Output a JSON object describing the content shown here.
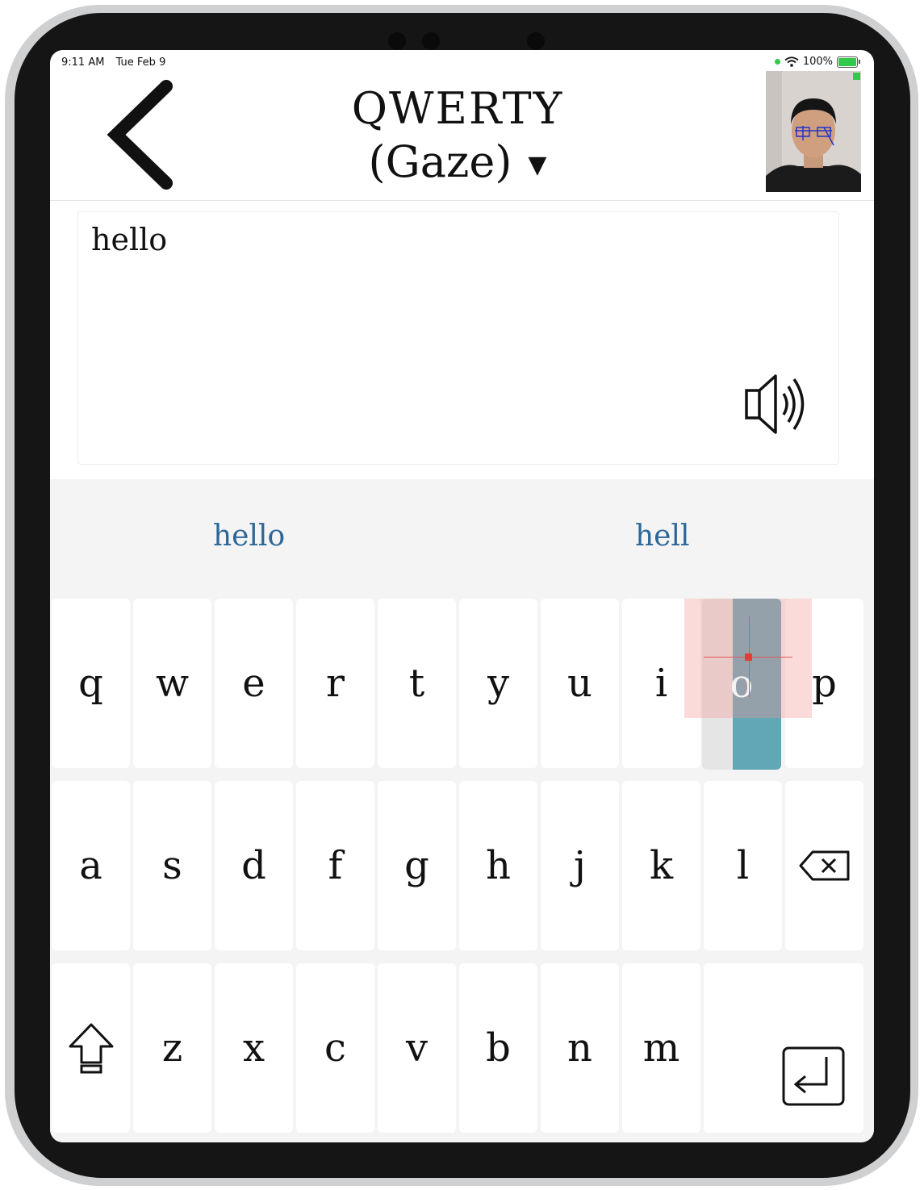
{
  "status_bar": {
    "time": "9:11 AM",
    "date": "Tue Feb 9",
    "battery": "100%"
  },
  "header": {
    "title_line1": "QWERTY",
    "title_line2": "(Gaze)",
    "dropdown_caret": "▼"
  },
  "text_area": {
    "value": "hello"
  },
  "suggestions": [
    "hello",
    "hell"
  ],
  "keyboard": {
    "row1": [
      "q",
      "w",
      "e",
      "r",
      "t",
      "y",
      "u",
      "i",
      "o",
      "p"
    ],
    "row2": [
      "a",
      "s",
      "d",
      "f",
      "g",
      "h",
      "j",
      "k",
      "l"
    ],
    "row3": [
      "z",
      "x",
      "c",
      "v",
      "b",
      "n",
      "m"
    ],
    "gaze_target_key": "o"
  },
  "icons": {
    "back": "chevron-left-icon",
    "speak": "speaker-icon",
    "delete": "backspace-icon",
    "shift": "shift-icon",
    "enter": "return-icon"
  },
  "colors": {
    "suggestion_text": "#2d6799",
    "gaze_highlight": "#62a7b5",
    "gaze_region": "#f49696",
    "keyboard_bg": "#f4f4f4"
  }
}
